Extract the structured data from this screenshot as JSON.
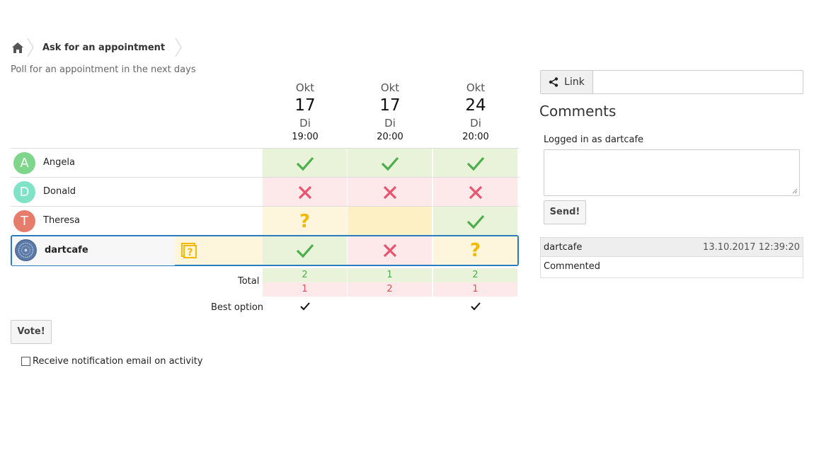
{
  "breadcrumb": {
    "home_icon": "home-icon",
    "title": "Ask for an appointment"
  },
  "subtitle": "Poll for an appointment in the next days",
  "dates": [
    {
      "month": "Okt",
      "day": "17",
      "weekday": "Di",
      "time": "19:00"
    },
    {
      "month": "Okt",
      "day": "17",
      "weekday": "Di",
      "time": "20:00"
    },
    {
      "month": "Okt",
      "day": "24",
      "weekday": "Di",
      "time": "20:00"
    }
  ],
  "participants": [
    {
      "name": "Angela",
      "initial": "A",
      "avatar_color": "#7ed68a",
      "votes": [
        "yes",
        "yes",
        "yes"
      ]
    },
    {
      "name": "Donald",
      "initial": "D",
      "avatar_color": "#7fe3c8",
      "votes": [
        "no",
        "no",
        "no"
      ]
    },
    {
      "name": "Theresa",
      "initial": "T",
      "avatar_color": "#e67c6b",
      "votes": [
        "maybe",
        "maybe-empty",
        "yes"
      ]
    },
    {
      "name": "dartcafe",
      "initial": "",
      "avatar_color": "#4a6a9a",
      "votes": [
        "yes",
        "no",
        "maybe"
      ]
    }
  ],
  "totals": {
    "label": "Total",
    "yes": [
      "2",
      "1",
      "2"
    ],
    "no": [
      "1",
      "2",
      "1"
    ]
  },
  "best_option": {
    "label": "Best option",
    "marks": [
      true,
      false,
      true
    ]
  },
  "vote_button": "Vote!",
  "notification_label": "Receive notification email on activity",
  "link_label": "Link",
  "comments": {
    "title": "Comments",
    "logged_in_as": "Logged in as dartcafe",
    "send_label": "Send!",
    "items": [
      {
        "author": "dartcafe",
        "date": "13.10.2017 12:39:20",
        "text": "Commented"
      }
    ]
  },
  "colors": {
    "yes": "#4cae4c",
    "no": "#e8536e",
    "maybe": "#f3b800",
    "active_border": "#2a7cc0"
  }
}
